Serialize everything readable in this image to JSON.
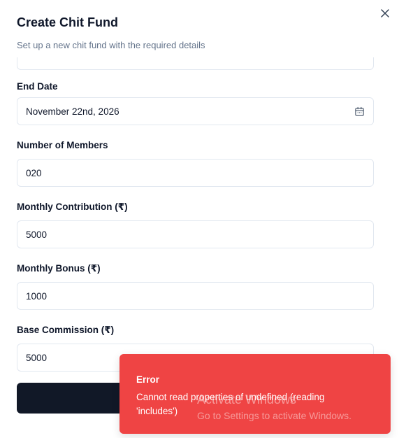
{
  "dialog": {
    "title": "Create Chit Fund",
    "subtitle": "Set up a new chit fund with the required details",
    "close_icon": "close-icon"
  },
  "fields": {
    "end_date": {
      "label": "End Date",
      "value": "November 22nd, 2026",
      "icon": "calendar-icon"
    },
    "members": {
      "label": "Number of Members",
      "value": "020"
    },
    "contribution": {
      "label": "Monthly Contribution (₹)",
      "value": "5000"
    },
    "bonus": {
      "label": "Monthly Bonus (₹)",
      "value": "1000"
    },
    "commission": {
      "label": "Base Commission (₹)",
      "value": "5000"
    }
  },
  "toast": {
    "title": "Error",
    "message": "Cannot read properties of undefined (reading 'includes')",
    "color": "#ef4444"
  },
  "watermark": {
    "title": "Activate Windows",
    "subtitle": "Go to Settings to activate Windows."
  },
  "colors": {
    "primary_button": "#111827",
    "border": "#e2e8f0",
    "muted_text": "#64748b"
  }
}
